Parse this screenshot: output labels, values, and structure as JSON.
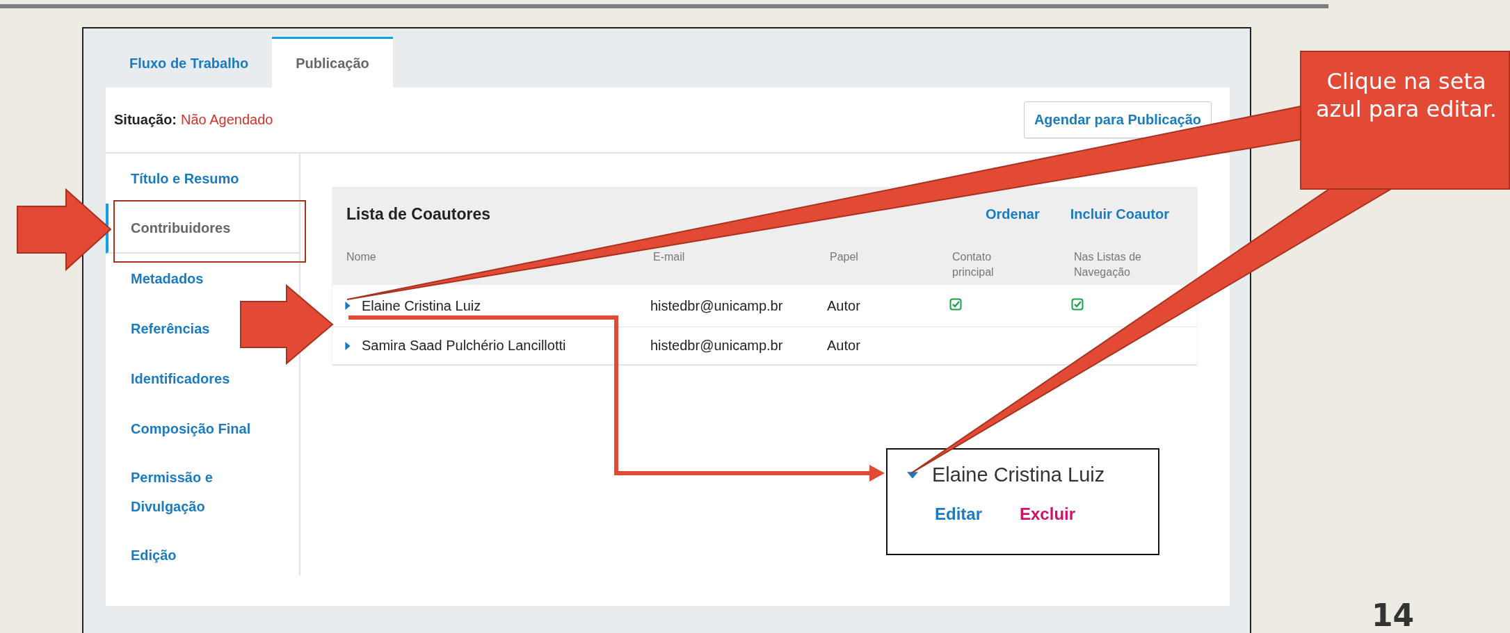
{
  "tabs": [
    {
      "label": "Fluxo de Trabalho",
      "selected": false
    },
    {
      "label": "Publicação",
      "selected": true
    }
  ],
  "status": {
    "label": "Situação:",
    "value": "Não Agendado"
  },
  "schedule_button": "Agendar para Publicação",
  "sidebar": {
    "items": [
      {
        "label": "Título e Resumo",
        "selected": false
      },
      {
        "label": "Contribuidores",
        "selected": true
      },
      {
        "label": "Metadados",
        "selected": false
      },
      {
        "label": "Referências",
        "selected": false
      },
      {
        "label": "Identificadores",
        "selected": false
      },
      {
        "label": "Composição Final",
        "selected": false
      },
      {
        "label": "Permissão e Divulgação",
        "selected": false
      },
      {
        "label": "Edição",
        "selected": false
      }
    ]
  },
  "contributors": {
    "title": "Lista de Coautores",
    "actions": [
      "Ordenar",
      "Incluir Coautor"
    ],
    "columns": [
      "Nome",
      "E-mail",
      "Papel",
      "Contato principal",
      "Nas Listas de Navegação"
    ],
    "rows": [
      {
        "name": "Elaine Cristina Luiz",
        "email": "histedbr@unicamp.br",
        "role": "Autor",
        "primary_contact": true,
        "in_browse_lists": true,
        "expanded": false
      },
      {
        "name": "Samira Saad Pulchério Lancillotti",
        "email": "histedbr@unicamp.br",
        "role": "Autor",
        "primary_contact": false,
        "in_browse_lists": false,
        "expanded": false
      }
    ]
  },
  "inset": {
    "name": "Elaine Cristina Luiz",
    "expanded": true,
    "actions": [
      {
        "label": "Editar",
        "kind": "edit"
      },
      {
        "label": "Excluir",
        "kind": "delete"
      }
    ]
  },
  "callout": {
    "text": "Clique na seta azul para editar."
  },
  "page_number": "14"
}
